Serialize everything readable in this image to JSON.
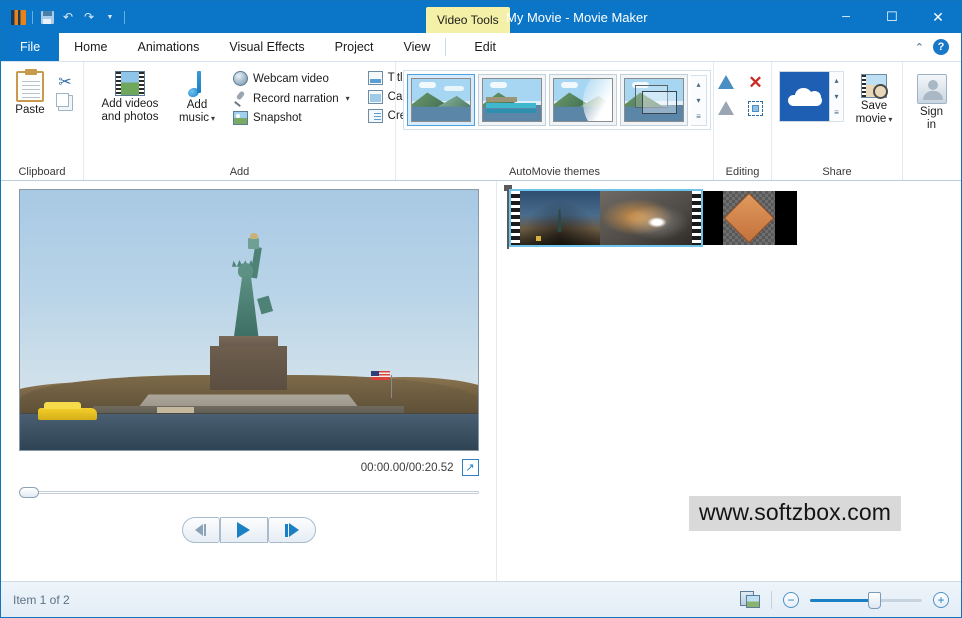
{
  "window": {
    "title": "My Movie - Movie Maker",
    "contextual_tab": "Video Tools",
    "minimize": "─",
    "maximize": "☐",
    "close": "✕"
  },
  "quick_access": {
    "app_icon": "movie-maker-icon",
    "save_icon": "save-icon",
    "undo_icon": "undo-icon",
    "redo_icon": "redo-icon",
    "customize_icon": "chevron-down-icon",
    "undo_glyph": "↶",
    "redo_glyph": "↷",
    "customize_glyph": "▼"
  },
  "tabs": [
    {
      "label": "File",
      "active": false
    },
    {
      "label": "Home",
      "active": true
    },
    {
      "label": "Animations",
      "active": false
    },
    {
      "label": "Visual Effects",
      "active": false
    },
    {
      "label": "Project",
      "active": false
    },
    {
      "label": "View",
      "active": false
    },
    {
      "label": "Edit",
      "active": false
    }
  ],
  "tabstrip_right": {
    "collapse_glyph": "⌃",
    "help_glyph": "?"
  },
  "ribbon": {
    "clipboard": {
      "group_label": "Clipboard",
      "paste_label": "Paste",
      "cut_name": "cut-icon",
      "cut_glyph": "✂",
      "copy_name": "copy-icon"
    },
    "add": {
      "group_label": "Add",
      "add_videos_line1": "Add videos",
      "add_videos_line2": "and photos",
      "add_music_line1": "Add",
      "add_music_line2": "music",
      "webcam_video": "Webcam video",
      "record_narration": "Record narration",
      "snapshot": "Snapshot",
      "title": "Title",
      "caption": "Caption",
      "credits": "Credits",
      "caret": "▾"
    },
    "themes": {
      "group_label": "AutoMovie themes",
      "items": [
        {
          "name": "theme-default",
          "selected": true
        },
        {
          "name": "theme-contemporary",
          "selected": false
        },
        {
          "name": "theme-cinematic",
          "selected": false
        },
        {
          "name": "theme-fade",
          "selected": false
        }
      ],
      "scroll_up": "▴",
      "scroll_down": "▾",
      "more": "≡"
    },
    "editing": {
      "group_label": "Editing",
      "rotate_left_name": "rotate-left-icon",
      "remove_name": "remove-icon",
      "remove_glyph": "✕",
      "rotate_right_name": "rotate-right-icon",
      "select_all_name": "select-all-icon"
    },
    "share": {
      "group_label": "Share",
      "onedrive_name": "onedrive-icon",
      "scroll_up": "▴",
      "scroll_down": "▾",
      "more": "≡",
      "save_movie_line1": "Save",
      "save_movie_line2": "movie",
      "caret": "▾"
    },
    "signin": {
      "line1": "Sign",
      "line2": "in"
    }
  },
  "preview": {
    "image_name": "statue-of-liberty-preview",
    "time": "00:00.00/00:20.52",
    "fullscreen_glyph": "↗",
    "controls": {
      "previous": "previous-frame-button",
      "play": "play-button",
      "next": "next-frame-button"
    }
  },
  "storyboard": {
    "clips": [
      {
        "name": "clip-statue-of-liberty-video",
        "selected": true
      },
      {
        "name": "clip-plaque-photo",
        "selected": false
      }
    ]
  },
  "watermark": "www.softzbox.com",
  "statusbar": {
    "item_status": "Item 1 of 2",
    "view_toggle_name": "storyboard-timeline-toggle-icon",
    "zoom_out_glyph": "−",
    "zoom_in_glyph": "+"
  },
  "colors": {
    "titlebar": "#0b76c8",
    "contextual_tab": "#f4f0a8",
    "accent": "#1b7fc4",
    "selection": "#6fc3ea",
    "remove_red": "#cc2b21"
  }
}
